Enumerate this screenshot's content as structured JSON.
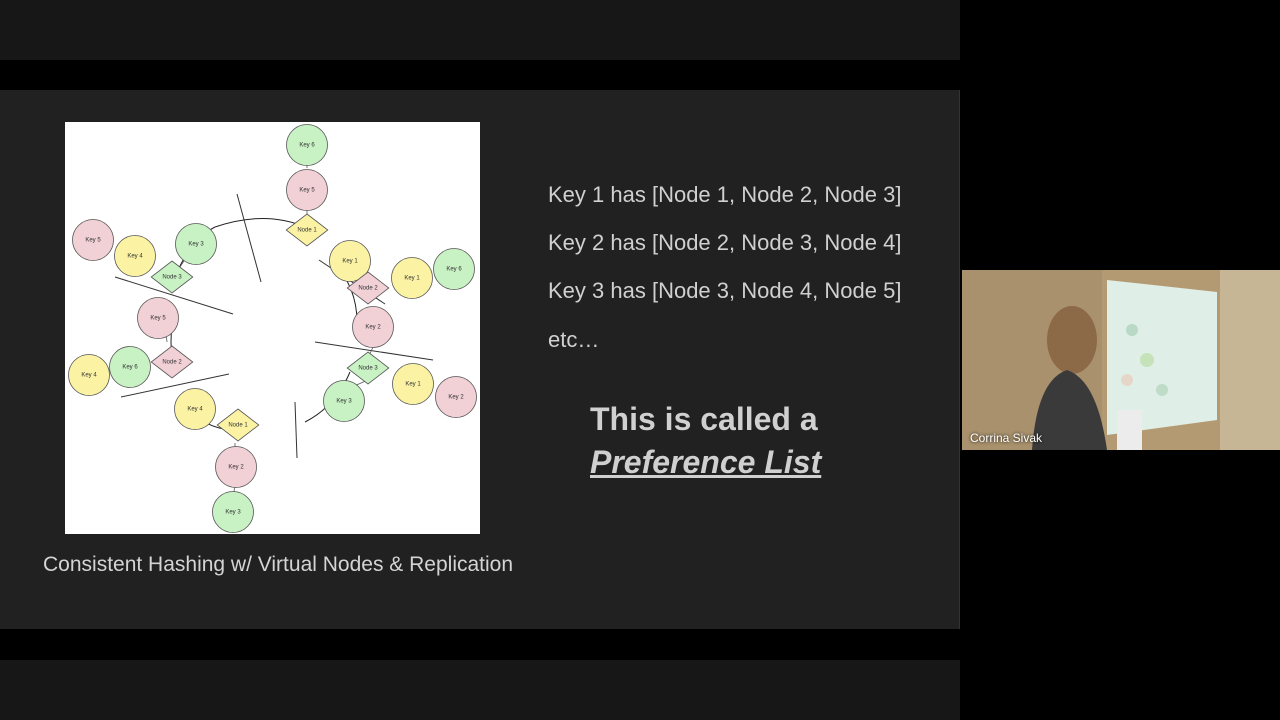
{
  "slide": {
    "caption": "Consistent Hashing w/ Virtual Nodes & Replication",
    "preference_lines": [
      "Key 1 has [Node 1, Node 2, Node 3]",
      "Key 2 has [Node 2, Node 3, Node 4]",
      "Key 3 has [Node 3, Node 4, Node 5]",
      "etc…"
    ],
    "callout_line1": "This is called a",
    "callout_emphasis": "Preference List"
  },
  "diagram": {
    "colors": {
      "pink": "#f1d0d6",
      "yellow": "#fbf3a3",
      "green": "#c8f1c4"
    },
    "circles": [
      {
        "label": "Key 6",
        "color": "green"
      },
      {
        "label": "Key 5",
        "color": "pink"
      },
      {
        "label": "Key 1",
        "color": "yellow"
      },
      {
        "label": "Key 6",
        "color": "green"
      },
      {
        "label": "Key 1",
        "color": "yellow"
      },
      {
        "label": "Key 2",
        "color": "pink"
      },
      {
        "label": "Key 1",
        "color": "yellow"
      },
      {
        "label": "Key 2",
        "color": "pink"
      },
      {
        "label": "Key 3",
        "color": "green"
      },
      {
        "label": "Key 2",
        "color": "pink"
      },
      {
        "label": "Key 3",
        "color": "green"
      },
      {
        "label": "Key 4",
        "color": "yellow"
      },
      {
        "label": "Key 5",
        "color": "pink"
      },
      {
        "label": "Key 6",
        "color": "green"
      },
      {
        "label": "Key 4",
        "color": "yellow"
      },
      {
        "label": "Key 5",
        "color": "pink"
      },
      {
        "label": "Key 4",
        "color": "yellow"
      },
      {
        "label": "Key 3",
        "color": "green"
      }
    ],
    "diamonds": [
      {
        "label": "Node 1",
        "color": "yellow"
      },
      {
        "label": "Node 2",
        "color": "pink"
      },
      {
        "label": "Node 3",
        "color": "green"
      },
      {
        "label": "Node 1",
        "color": "yellow"
      },
      {
        "label": "Node 2",
        "color": "pink"
      },
      {
        "label": "Node 3",
        "color": "green"
      }
    ]
  },
  "video": {
    "participant_name": "Corrina Sivak"
  }
}
